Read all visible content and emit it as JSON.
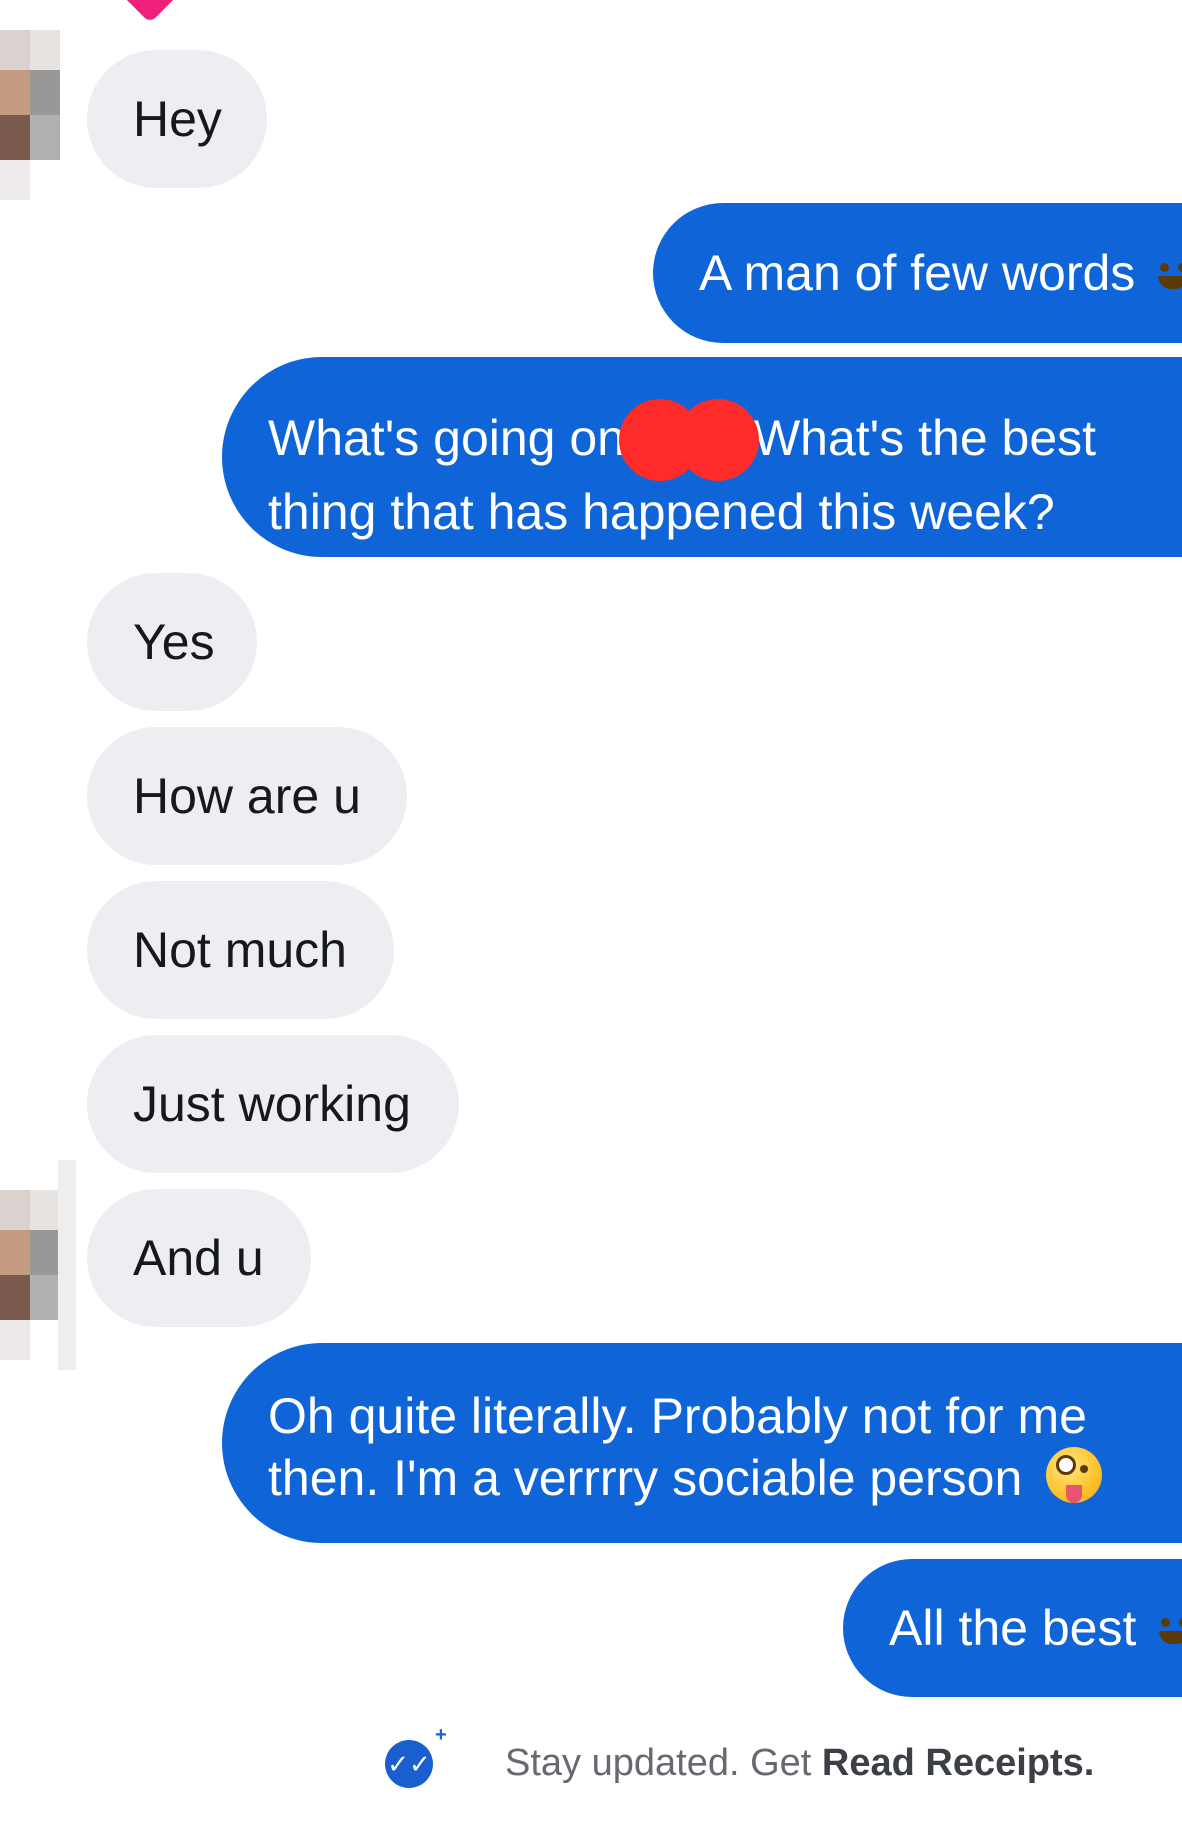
{
  "messages": [
    {
      "id": "m1",
      "dir": "in",
      "text": "Hey"
    },
    {
      "id": "m2",
      "dir": "out",
      "text": "A man of few words",
      "emoji": "grinning-sweat-face"
    },
    {
      "id": "m3",
      "dir": "out",
      "text_a": "What's going on",
      "text_b": "What's the best",
      "text_c": "thing that has happened this week?",
      "redacted": true
    },
    {
      "id": "m4",
      "dir": "in",
      "text": "Yes"
    },
    {
      "id": "m5",
      "dir": "in",
      "text": "How are u"
    },
    {
      "id": "m6",
      "dir": "in",
      "text": "Not much"
    },
    {
      "id": "m7",
      "dir": "in",
      "text": "Just working"
    },
    {
      "id": "m8",
      "dir": "in",
      "text": "And u"
    },
    {
      "id": "m9",
      "dir": "out",
      "line1": "Oh quite literally. Probably not for me",
      "line2": "then. I'm a verrrry sociable person",
      "emoji": "zany-face"
    },
    {
      "id": "m10",
      "dir": "out",
      "text": "All the best",
      "emoji": "grinning-sweat-face"
    }
  ],
  "footer": {
    "prefix": "Stay updated. Get ",
    "link": "Read Receipts.",
    "icon": "double-check-icon",
    "icon_plus": "+"
  },
  "colors": {
    "outgoing": "#0f65d8",
    "incoming": "#eceef1",
    "redaction": "#ff2a2a"
  }
}
